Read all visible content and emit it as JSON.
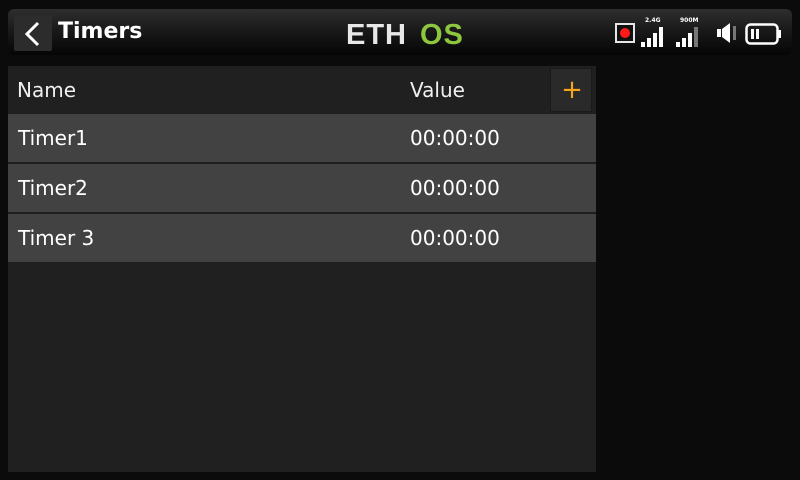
{
  "header": {
    "title": "Timers",
    "logo_text_left": "ETH",
    "logo_text_right": "OS",
    "status": {
      "rf_band_1": "2.4G",
      "rf_band_2": "900M"
    }
  },
  "table": {
    "columns": [
      "Name",
      "Value"
    ],
    "add_label": "+",
    "rows": [
      {
        "name": "Timer1",
        "value": "00:00:00"
      },
      {
        "name": "Timer2",
        "value": "00:00:00"
      },
      {
        "name": "Timer 3",
        "value": "00:00:00"
      }
    ]
  },
  "colors": {
    "accent": "#f7a51c",
    "logo_green": "#8dc63f",
    "row_bg": "#424242",
    "panel_bg": "#202020"
  }
}
